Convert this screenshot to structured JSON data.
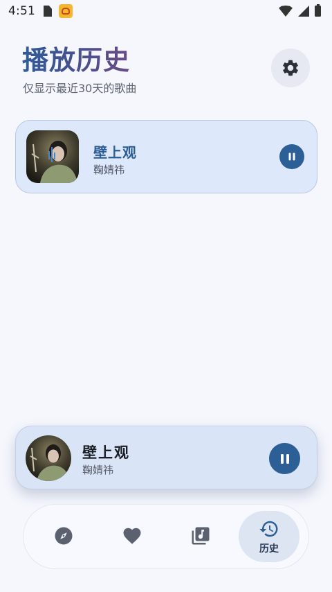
{
  "status_bar": {
    "time": "4:51"
  },
  "header": {
    "title": "播放历史",
    "subtitle": "仅显示最近30天的歌曲"
  },
  "history": {
    "items": [
      {
        "title": "壁上观",
        "artist": "鞠婧祎"
      }
    ]
  },
  "mini_player": {
    "title": "壁上观",
    "artist": "鞠婧祎"
  },
  "bottom_nav": {
    "items": [
      {
        "icon": "compass-icon",
        "label": ""
      },
      {
        "icon": "heart-icon",
        "label": ""
      },
      {
        "icon": "music-library-icon",
        "label": ""
      },
      {
        "icon": "history-icon",
        "label": "历史",
        "active": true
      }
    ]
  },
  "colors": {
    "accent": "#2d5f97",
    "card_bg": "#dde8fb",
    "page_bg": "#f5f7fd"
  }
}
